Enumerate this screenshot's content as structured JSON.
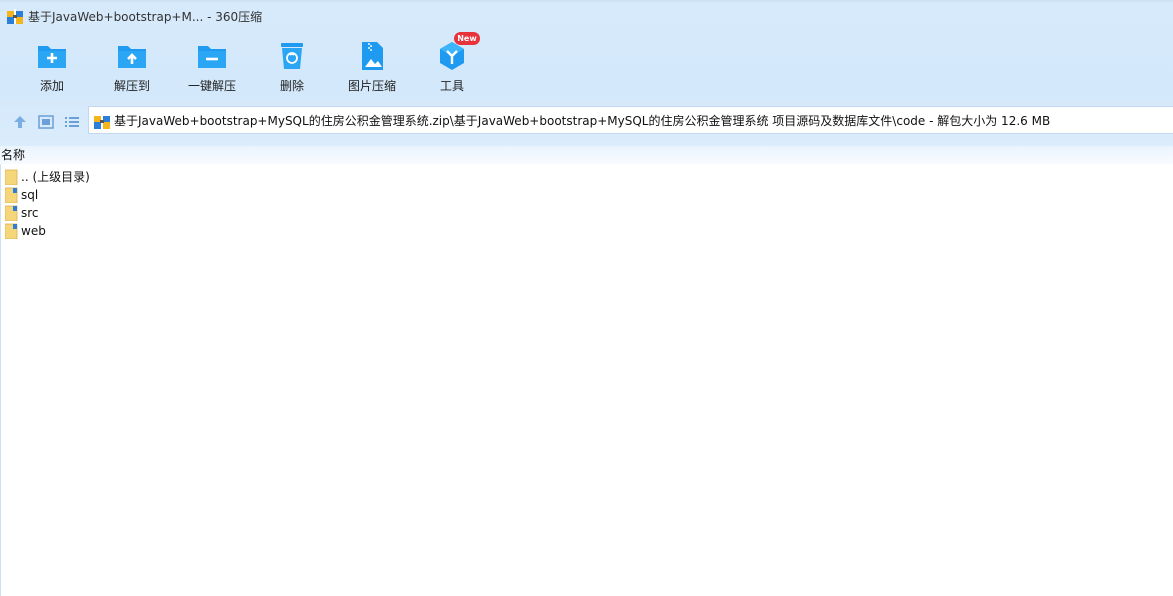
{
  "window": {
    "title": "基于JavaWeb+bootstrap+M... - 360压缩",
    "app_icon": "archive-app-icon"
  },
  "toolbar": {
    "items": [
      {
        "label": "添加",
        "icon": "add-folder-icon"
      },
      {
        "label": "解压到",
        "icon": "extract-to-icon"
      },
      {
        "label": "一键解压",
        "icon": "one-click-extract-icon"
      },
      {
        "label": "删除",
        "icon": "trash-icon"
      },
      {
        "label": "图片压缩",
        "icon": "image-compress-icon"
      },
      {
        "label": "工具",
        "icon": "tools-icon"
      }
    ],
    "new_badge": "New"
  },
  "address": {
    "path": "基于JavaWeb+bootstrap+MySQL的住房公积金管理系统.zip\\基于JavaWeb+bootstrap+MySQL的住房公积金管理系统 项目源码及数据库文件\\code - 解包大小为 12.6 MB"
  },
  "list": {
    "column_name": "名称",
    "items": [
      {
        "name": ".. (上级目录)",
        "type": "parent-folder"
      },
      {
        "name": "sql",
        "type": "folder"
      },
      {
        "name": "src",
        "type": "folder"
      },
      {
        "name": "web",
        "type": "folder"
      }
    ]
  },
  "colors": {
    "accent": "#1e9af0",
    "header_bg": "#d5e9fb",
    "badge": "#e8333a",
    "folder": "#f6d67a"
  }
}
